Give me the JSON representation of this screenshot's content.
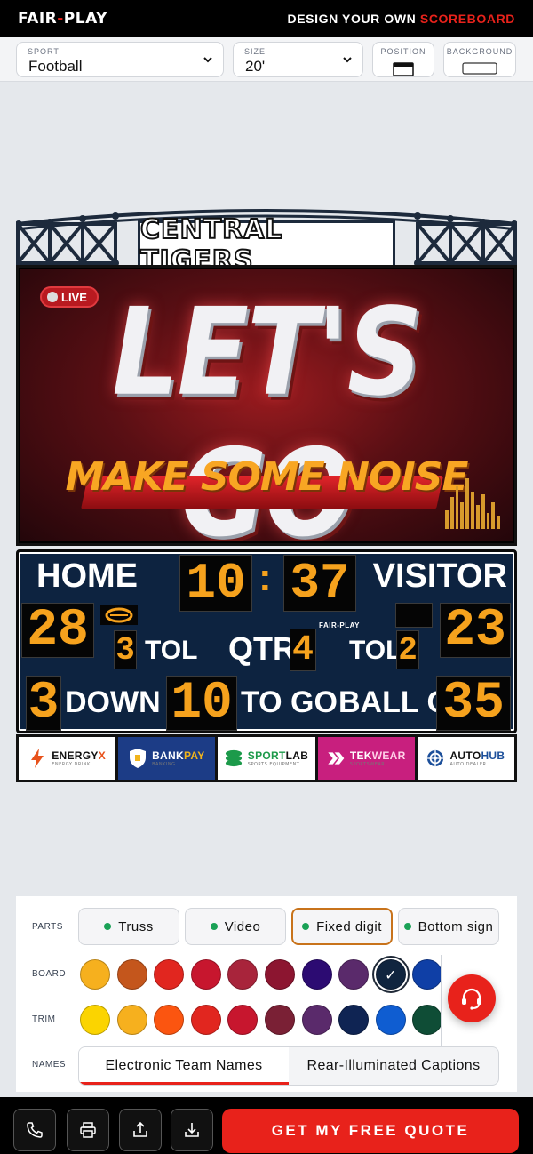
{
  "header": {
    "logo_left": "FAIR",
    "logo_dash": "-",
    "logo_right": "PLAY",
    "tagline": "DESIGN YOUR OWN",
    "tagline_accent": "SCOREBOARD"
  },
  "controls": {
    "sport_label": "SPORT",
    "sport_value": "Football",
    "size_label": "SIZE",
    "size_value": "20'",
    "position_label": "POSITION",
    "background_label": "BACKGROUND"
  },
  "scoreboard": {
    "team_name": "CENTRAL TIGERS",
    "video": {
      "live": "LIVE",
      "headline": "LET'S GO",
      "subhead": "MAKE SOME NOISE",
      "eq_levels": [
        0.35,
        0.6,
        0.8,
        0.5,
        0.95,
        0.7,
        0.45,
        0.65,
        0.3,
        0.5,
        0.25
      ]
    },
    "home_label": "HOME",
    "visitor_label": "VISITOR",
    "clock_min": "10",
    "clock_sec": "37",
    "home_score": "28",
    "visitor_score": "23",
    "home_tol": "3",
    "visitor_tol": "2",
    "tol_label": "TOL",
    "qtr_label": "QTR",
    "qtr_value": "4",
    "brand_small": "FAIR-PLAY",
    "down_value": "3",
    "down_label": "DOWN",
    "togo_value": "10",
    "togo_label": "TO GO",
    "ballon_label": "BALL ON",
    "ballon_value": "35"
  },
  "sponsors": [
    {
      "name_a": "ENERGY",
      "name_b": "X",
      "sub": "ENERGY DRINK",
      "bg": "#ffffff",
      "color_a": "#111111",
      "color_b": "#e8521b",
      "icon": "lightning-icon"
    },
    {
      "name_a": "BANK",
      "name_b": "PAY",
      "sub": "BANKING",
      "bg": "#1c3c86",
      "color_a": "#ffffff",
      "color_b": "#f2b51b",
      "icon": "shield-icon"
    },
    {
      "name_a": "SPORT",
      "name_b": "LAB",
      "sub": "SPORTS EQUIPMENT",
      "bg": "#ffffff",
      "color_a": "#1c9a4a",
      "color_b": "#111111",
      "icon": "stack-icon"
    },
    {
      "name_a": "TEK",
      "name_b": "WEAR",
      "sub": "SPORTSWEAR",
      "bg": "#c81f7e",
      "color_a": "#ffffff",
      "color_b": "#ffd1e8",
      "icon": "chevrons-icon"
    },
    {
      "name_a": "AUTO",
      "name_b": "HUB",
      "sub": "AUTO DEALER",
      "bg": "#ffffff",
      "color_a": "#111111",
      "color_b": "#1c4f9a",
      "icon": "wheel-icon"
    }
  ],
  "options": {
    "parts_label": "PARTS",
    "board_label": "BOARD",
    "trim_label": "TRIM",
    "names_label": "NAMES",
    "parts": [
      {
        "label": "Truss",
        "active": false
      },
      {
        "label": "Video",
        "active": false
      },
      {
        "label": "Fixed digit",
        "active": true
      },
      {
        "label": "Bottom sign",
        "active": false
      }
    ],
    "board_colors": [
      "#f6b01e",
      "#c4561c",
      "#e1261f",
      "#c7162e",
      "#a8243b",
      "#8c1530",
      "#2c0b72",
      "#5a2a6b",
      "#10253f",
      "#0f3fa6"
    ],
    "board_selected": 8,
    "trim_colors": [
      "#fbd400",
      "#f6b01e",
      "#fb5510",
      "#e1261f",
      "#c7162e",
      "#7a2035",
      "#5a2a6b",
      "#0f2453",
      "#0f5dd1",
      "#0f4d36"
    ],
    "name_options": [
      "Electronic Team Names",
      "Rear-Illuminated Captions"
    ],
    "name_selected": 0
  },
  "bottom": {
    "cta": "GET MY FREE QUOTE"
  }
}
